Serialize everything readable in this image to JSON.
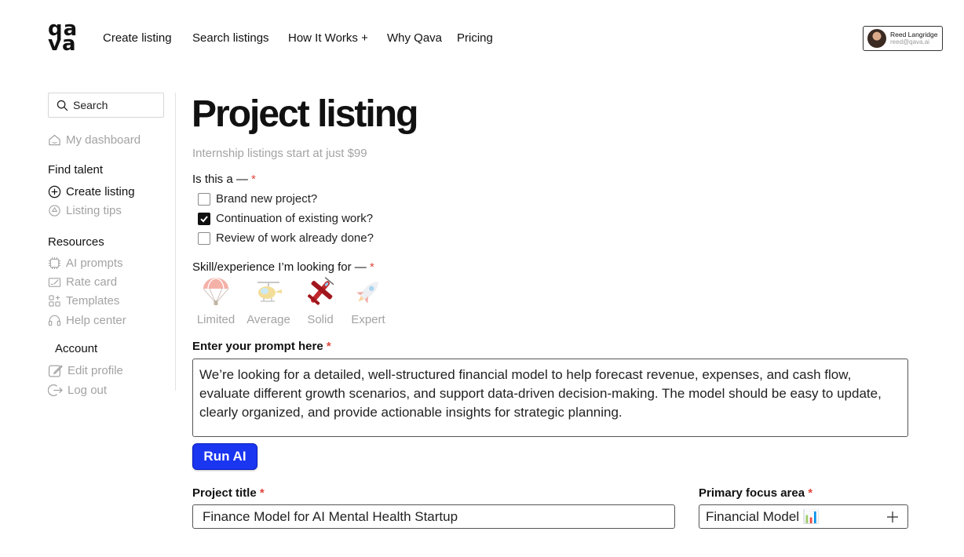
{
  "brand": {
    "logo_line1": "qa",
    "logo_line2": "va"
  },
  "nav": {
    "items": [
      {
        "label": "Create listing"
      },
      {
        "label": "Search listings"
      },
      {
        "label": "How It Works +"
      },
      {
        "label": "Why Qava"
      },
      {
        "label": "Pricing"
      }
    ]
  },
  "user": {
    "name": "Reed Langridge",
    "email": "reed@qava.ai"
  },
  "sidebar": {
    "search_placeholder": "Search",
    "dashboard": "My dashboard",
    "sections": [
      {
        "heading": "Find talent",
        "items": [
          {
            "label": "Create listing",
            "icon": "plus-circle-icon"
          },
          {
            "label": "Listing tips",
            "icon": "tips-icon"
          }
        ]
      },
      {
        "heading": "Resources",
        "items": [
          {
            "label": "AI prompts",
            "icon": "chip-icon"
          },
          {
            "label": "Rate card",
            "icon": "rate-card-icon"
          },
          {
            "label": "Templates",
            "icon": "templates-icon"
          },
          {
            "label": "Help center",
            "icon": "headset-icon"
          }
        ]
      },
      {
        "heading": "Account",
        "items": [
          {
            "label": "Edit profile",
            "icon": "edit-icon"
          },
          {
            "label": "Log out",
            "icon": "logout-icon"
          }
        ]
      }
    ]
  },
  "main": {
    "title": "Project listing",
    "subtitle": "Internship listings start at just $99",
    "project_type": {
      "label": "Is this a —",
      "options": [
        {
          "label": "Brand new project?",
          "checked": false
        },
        {
          "label": "Continuation of existing work?",
          "checked": true
        },
        {
          "label": "Review of work already done?",
          "checked": false
        }
      ]
    },
    "skill": {
      "label": "Skill/experience I’m looking for —",
      "levels": [
        {
          "label": "Limited",
          "icon": "parachute-icon",
          "selected": false
        },
        {
          "label": "Average",
          "icon": "helicopter-icon",
          "selected": false
        },
        {
          "label": "Solid",
          "icon": "airplane-icon",
          "selected": true
        },
        {
          "label": "Expert",
          "icon": "rocket-icon",
          "selected": false
        }
      ]
    },
    "prompt": {
      "label": "Enter your prompt here",
      "value": " We’re looking for a detailed, well-structured financial model to help forecast revenue, expenses, and cash flow, evaluate different growth scenarios, and support data-driven decision-making. The model should be easy to update, clearly organized, and provide actionable insights for strategic planning."
    },
    "run_button": "Run AI",
    "project_title": {
      "label": "Project title",
      "value": "Finance Model for AI Mental Health Startup"
    },
    "focus_area": {
      "label": "Primary focus area",
      "value": "Financial Model 📊"
    },
    "required_mark": "*",
    "colors": {
      "accent": "#1a36f0",
      "required": "#e0473c",
      "muted": "#a3a3a3"
    }
  }
}
